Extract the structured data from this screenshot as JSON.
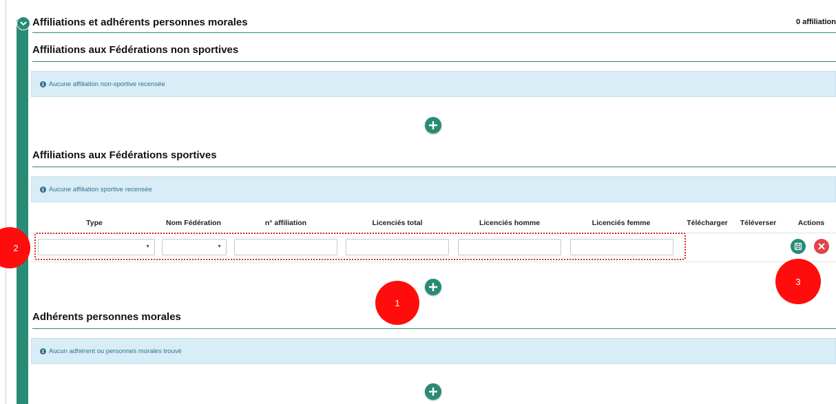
{
  "header": {
    "title": "Affiliations et adhérents personnes morales",
    "count": "0 affiliation"
  },
  "sections": {
    "non_sport": {
      "title": "Affiliations aux Fédérations non sportives",
      "empty_message": "Aucune affiliation non-sportive recensée"
    },
    "sport": {
      "title": "Affiliations aux Fédérations sportives",
      "empty_message": "Aucune affiliation sportive recensée",
      "columns": [
        "Type",
        "Nom Fédération",
        "n° affiliation",
        "Licenciés total",
        "Licenciés homme",
        "Licenciés femme",
        "Télécharger",
        "Téléverser",
        "Actions"
      ],
      "row": {
        "type": "",
        "federation": "",
        "affiliation_number": "",
        "total": "",
        "men": "",
        "women": ""
      }
    },
    "members": {
      "title": "Adhérents personnes morales",
      "empty_message": "Aucun adhérent ou personnes morales trouvé"
    }
  },
  "markers": [
    "1",
    "2",
    "3"
  ],
  "icons": {
    "info": "info-icon",
    "add": "plus-circle-icon",
    "save": "floppy-disk-icon",
    "cancel": "close-icon",
    "collapse": "chevron-down-icon"
  },
  "colors": {
    "accent": "#2a8b75",
    "info_bg": "#d9edf7",
    "info_text": "#31708f",
    "danger": "#e0454b",
    "marker": "#ff0d0d"
  }
}
